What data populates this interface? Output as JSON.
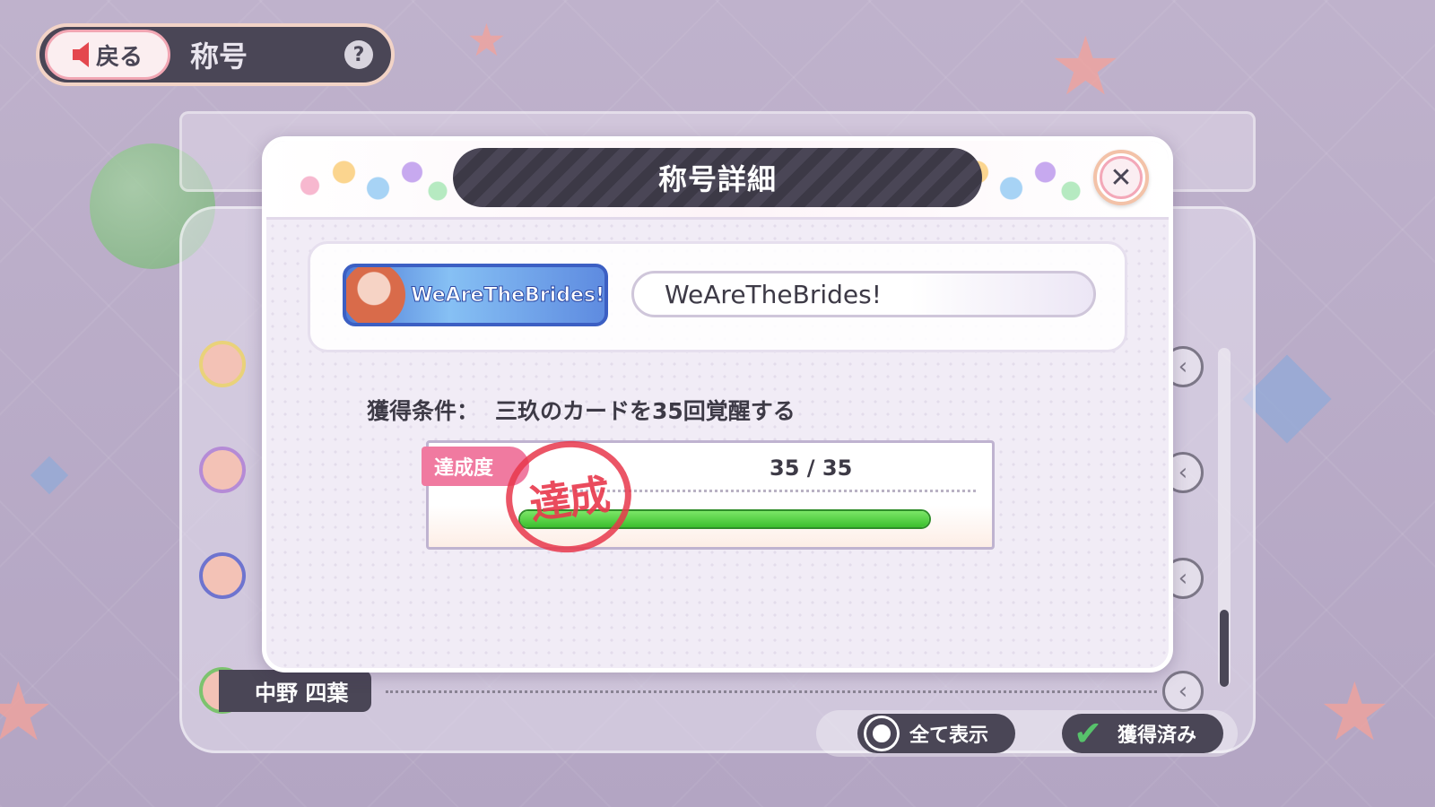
{
  "topbar": {
    "back_label": "戻る",
    "title": "称号",
    "help_symbol": "?"
  },
  "background_list": {
    "visible_row_name": "中野 四葉"
  },
  "filters": {
    "show_all_label": "全て表示",
    "acquired_label": "獲得済み"
  },
  "modal": {
    "title": "称号詳細",
    "close_symbol": "✕",
    "title_plate_text": "WeAreTheBrides!",
    "title_name": "WeAreTheBrides!",
    "condition_label": "獲得条件：",
    "condition_text": "三玖のカードを35回覚醒する",
    "progress_label": "達成度",
    "progress_count": "35 / 35",
    "progress_fraction": 1.0,
    "stamp_text": "達成"
  },
  "colors": {
    "accent_pink": "#f07aa0",
    "progress_green": "#3bbf2d",
    "dark_bar": "#4a4656",
    "stamp_red": "#e8374b"
  },
  "icons": {
    "back": "left-arrow-icon",
    "help": "question-icon",
    "close": "close-icon",
    "chevron": "chevron-left-icon",
    "radio": "radio-icon",
    "check": "check-icon"
  }
}
